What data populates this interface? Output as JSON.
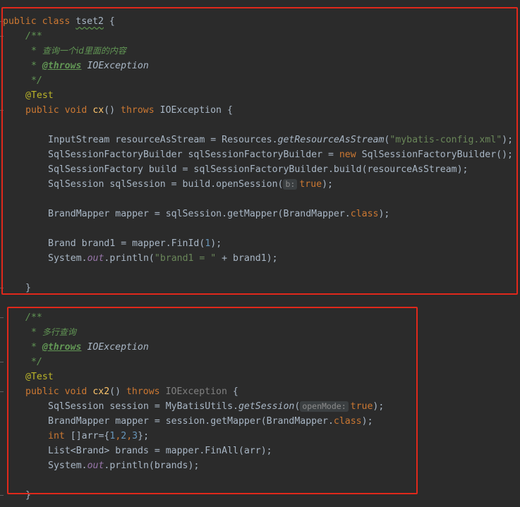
{
  "colors": {
    "background": "#2b2b2b",
    "keyword": "#cc7832",
    "annotation": "#bbb529",
    "comment": "#629755",
    "method": "#ffc66d",
    "string": "#6a8759",
    "number": "#6897bb",
    "highlight_box": "#e0281b"
  },
  "code": {
    "l1_public": "public",
    "l1_class": "class",
    "l1_name": "tset2",
    "l1_brace": "{",
    "doc_open": "/**",
    "doc1_star": "*",
    "doc1_text": "查询一个id里面的内容",
    "throws_tag": "@throws",
    "throws_type": "IOException",
    "doc_close": "*/",
    "test_ann": "@Test",
    "m1_public": "public",
    "m1_void": "void",
    "m1_name": "cx",
    "m1_parens": "()",
    "m1_throws": "throws",
    "m1_exc": "IOException",
    "m1_brace": "{",
    "s1_a": "InputStream resourceAsStream = Resources.",
    "s1_fn": "getResourceAsStream",
    "s1_b": "(",
    "s1_str": "\"mybatis-config.xml\"",
    "s1_c": ");",
    "s2_a": "SqlSessionFactoryBuilder sqlSessionFactoryBuilder = ",
    "s2_new": "new",
    "s2_b": " SqlSessionFactoryBuilder();",
    "s3": "SqlSessionFactory build = sqlSessionFactoryBuilder.build(resourceAsStream);",
    "s4_a": "SqlSession sqlSession = build.openSession(",
    "s4_hint": "b:",
    "s4_true": "true",
    "s4_b": ");",
    "s5_a": "BrandMapper mapper = sqlSession.getMapper(BrandMapper.",
    "s5_class": "class",
    "s5_b": ");",
    "s6_a": "Brand brand1 = mapper.FinId(",
    "s6_num": "1",
    "s6_b": ");",
    "s7_a": "System.",
    "s7_out": "out",
    "s7_b": ".println(",
    "s7_str": "\"brand1 = \"",
    "s7_c": " + brand1);",
    "m1_close": "}",
    "doc2_text": "多行查询",
    "m2_name": "cx2",
    "t1_a": "SqlSession session = MyBatisUtils.",
    "t1_fn": "getSession",
    "t1_b": "(",
    "t1_hint": "openMode:",
    "t1_true": "true",
    "t1_c": ");",
    "t2_a": "BrandMapper mapper = session.getMapper(BrandMapper.",
    "t2_class": "class",
    "t2_b": ");",
    "t3_int": "int",
    "t3_a": " []arr={",
    "t3_n1": "1",
    "t3_n2": "2",
    "t3_n3": "3",
    "t3_comma": ",",
    "t3_b": "};",
    "t4": "List<Brand> brands = mapper.FinAll(arr);",
    "t5_a": "System.",
    "t5_out": "out",
    "t5_b": ".println(brands);",
    "m2_close": "}"
  }
}
